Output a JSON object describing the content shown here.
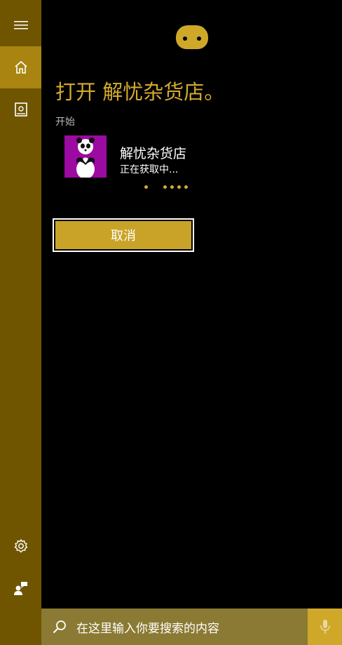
{
  "sidebar": {
    "items": [
      {
        "name": "menu",
        "icon": "hamburger-icon"
      },
      {
        "name": "home",
        "icon": "home-icon",
        "active": true
      },
      {
        "name": "notebook",
        "icon": "notebook-icon"
      },
      {
        "name": "settings",
        "icon": "gear-icon"
      },
      {
        "name": "feedback",
        "icon": "feedback-icon"
      }
    ]
  },
  "main": {
    "title": "打开 解忧杂货店。",
    "section_label": "开始",
    "app": {
      "name": "解忧杂货店",
      "status": "正在获取中...",
      "icon_background": "#9b0aa1"
    },
    "cancel_label": "取消"
  },
  "search": {
    "placeholder": "在这里输入你要搜索的内容"
  },
  "colors": {
    "accent": "#d3aa2d",
    "sidebar": "#6f5500",
    "sidebar_active": "#a98410",
    "searchbar": "#8b7a33"
  }
}
